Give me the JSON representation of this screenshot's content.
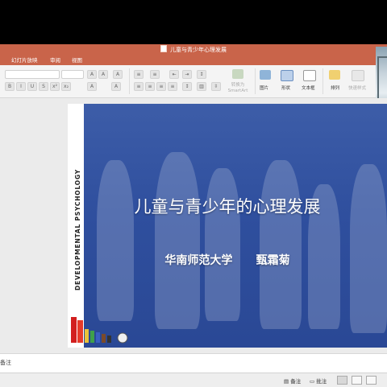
{
  "window": {
    "title": "儿童与青少年心理发展"
  },
  "menu": {
    "items": [
      "幻灯片放映",
      "审阅",
      "视图"
    ]
  },
  "ribbon": {
    "font_name": "",
    "font_size": "",
    "format_buttons": [
      "B",
      "I",
      "U",
      "S",
      "x²",
      "x₂"
    ],
    "convert_smartart": "转换为 SmartArt",
    "picture": "图片",
    "shape": "形状",
    "textbox": "文本框",
    "arrange": "排列",
    "quick_styles": "快速样式"
  },
  "slide": {
    "vertical_text": "DEVELOPMENTAL PSYCHOLOGY",
    "title": "儿童与青少年的心理发展",
    "subtitle": "华南师范大学      甄霜菊"
  },
  "notes": {
    "label": "备注"
  },
  "status": {
    "notes_button": "备注",
    "comments_button": "批注"
  },
  "colors": {
    "accent": "#c9644a",
    "slide_bg": "#274a96"
  }
}
